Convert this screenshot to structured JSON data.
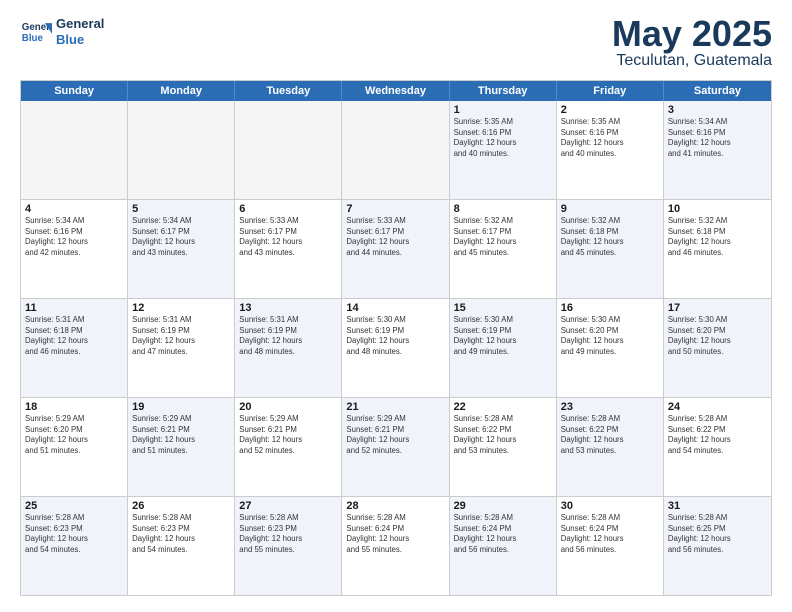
{
  "logo": {
    "line1": "General",
    "line2": "Blue"
  },
  "title": "May 2025",
  "subtitle": "Teculutan, Guatemala",
  "days": [
    "Sunday",
    "Monday",
    "Tuesday",
    "Wednesday",
    "Thursday",
    "Friday",
    "Saturday"
  ],
  "rows": [
    [
      {
        "day": "",
        "info": "",
        "empty": true
      },
      {
        "day": "",
        "info": "",
        "empty": true
      },
      {
        "day": "",
        "info": "",
        "empty": true
      },
      {
        "day": "",
        "info": "",
        "empty": true
      },
      {
        "day": "1",
        "info": "Sunrise: 5:35 AM\nSunset: 6:16 PM\nDaylight: 12 hours\nand 40 minutes.",
        "shaded": true
      },
      {
        "day": "2",
        "info": "Sunrise: 5:35 AM\nSunset: 6:16 PM\nDaylight: 12 hours\nand 40 minutes.",
        "shaded": false
      },
      {
        "day": "3",
        "info": "Sunrise: 5:34 AM\nSunset: 6:16 PM\nDaylight: 12 hours\nand 41 minutes.",
        "shaded": true
      }
    ],
    [
      {
        "day": "4",
        "info": "Sunrise: 5:34 AM\nSunset: 6:16 PM\nDaylight: 12 hours\nand 42 minutes.",
        "shaded": false
      },
      {
        "day": "5",
        "info": "Sunrise: 5:34 AM\nSunset: 6:17 PM\nDaylight: 12 hours\nand 43 minutes.",
        "shaded": true
      },
      {
        "day": "6",
        "info": "Sunrise: 5:33 AM\nSunset: 6:17 PM\nDaylight: 12 hours\nand 43 minutes.",
        "shaded": false
      },
      {
        "day": "7",
        "info": "Sunrise: 5:33 AM\nSunset: 6:17 PM\nDaylight: 12 hours\nand 44 minutes.",
        "shaded": true
      },
      {
        "day": "8",
        "info": "Sunrise: 5:32 AM\nSunset: 6:17 PM\nDaylight: 12 hours\nand 45 minutes.",
        "shaded": false
      },
      {
        "day": "9",
        "info": "Sunrise: 5:32 AM\nSunset: 6:18 PM\nDaylight: 12 hours\nand 45 minutes.",
        "shaded": true
      },
      {
        "day": "10",
        "info": "Sunrise: 5:32 AM\nSunset: 6:18 PM\nDaylight: 12 hours\nand 46 minutes.",
        "shaded": false
      }
    ],
    [
      {
        "day": "11",
        "info": "Sunrise: 5:31 AM\nSunset: 6:18 PM\nDaylight: 12 hours\nand 46 minutes.",
        "shaded": true
      },
      {
        "day": "12",
        "info": "Sunrise: 5:31 AM\nSunset: 6:19 PM\nDaylight: 12 hours\nand 47 minutes.",
        "shaded": false
      },
      {
        "day": "13",
        "info": "Sunrise: 5:31 AM\nSunset: 6:19 PM\nDaylight: 12 hours\nand 48 minutes.",
        "shaded": true
      },
      {
        "day": "14",
        "info": "Sunrise: 5:30 AM\nSunset: 6:19 PM\nDaylight: 12 hours\nand 48 minutes.",
        "shaded": false
      },
      {
        "day": "15",
        "info": "Sunrise: 5:30 AM\nSunset: 6:19 PM\nDaylight: 12 hours\nand 49 minutes.",
        "shaded": true
      },
      {
        "day": "16",
        "info": "Sunrise: 5:30 AM\nSunset: 6:20 PM\nDaylight: 12 hours\nand 49 minutes.",
        "shaded": false
      },
      {
        "day": "17",
        "info": "Sunrise: 5:30 AM\nSunset: 6:20 PM\nDaylight: 12 hours\nand 50 minutes.",
        "shaded": true
      }
    ],
    [
      {
        "day": "18",
        "info": "Sunrise: 5:29 AM\nSunset: 6:20 PM\nDaylight: 12 hours\nand 51 minutes.",
        "shaded": false
      },
      {
        "day": "19",
        "info": "Sunrise: 5:29 AM\nSunset: 6:21 PM\nDaylight: 12 hours\nand 51 minutes.",
        "shaded": true
      },
      {
        "day": "20",
        "info": "Sunrise: 5:29 AM\nSunset: 6:21 PM\nDaylight: 12 hours\nand 52 minutes.",
        "shaded": false
      },
      {
        "day": "21",
        "info": "Sunrise: 5:29 AM\nSunset: 6:21 PM\nDaylight: 12 hours\nand 52 minutes.",
        "shaded": true
      },
      {
        "day": "22",
        "info": "Sunrise: 5:28 AM\nSunset: 6:22 PM\nDaylight: 12 hours\nand 53 minutes.",
        "shaded": false
      },
      {
        "day": "23",
        "info": "Sunrise: 5:28 AM\nSunset: 6:22 PM\nDaylight: 12 hours\nand 53 minutes.",
        "shaded": true
      },
      {
        "day": "24",
        "info": "Sunrise: 5:28 AM\nSunset: 6:22 PM\nDaylight: 12 hours\nand 54 minutes.",
        "shaded": false
      }
    ],
    [
      {
        "day": "25",
        "info": "Sunrise: 5:28 AM\nSunset: 6:23 PM\nDaylight: 12 hours\nand 54 minutes.",
        "shaded": true
      },
      {
        "day": "26",
        "info": "Sunrise: 5:28 AM\nSunset: 6:23 PM\nDaylight: 12 hours\nand 54 minutes.",
        "shaded": false
      },
      {
        "day": "27",
        "info": "Sunrise: 5:28 AM\nSunset: 6:23 PM\nDaylight: 12 hours\nand 55 minutes.",
        "shaded": true
      },
      {
        "day": "28",
        "info": "Sunrise: 5:28 AM\nSunset: 6:24 PM\nDaylight: 12 hours\nand 55 minutes.",
        "shaded": false
      },
      {
        "day": "29",
        "info": "Sunrise: 5:28 AM\nSunset: 6:24 PM\nDaylight: 12 hours\nand 56 minutes.",
        "shaded": true
      },
      {
        "day": "30",
        "info": "Sunrise: 5:28 AM\nSunset: 6:24 PM\nDaylight: 12 hours\nand 56 minutes.",
        "shaded": false
      },
      {
        "day": "31",
        "info": "Sunrise: 5:28 AM\nSunset: 6:25 PM\nDaylight: 12 hours\nand 56 minutes.",
        "shaded": true
      }
    ]
  ]
}
